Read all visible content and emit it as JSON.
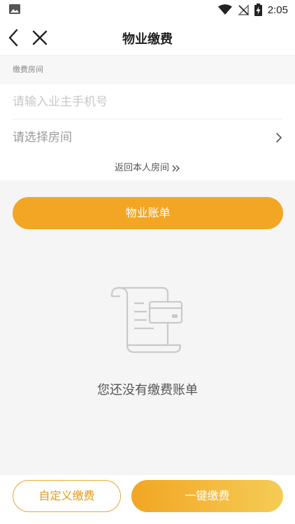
{
  "status_bar": {
    "time": "2:05"
  },
  "navbar": {
    "title": "物业缴费"
  },
  "section": {
    "label": "缴费房间"
  },
  "form": {
    "phone_placeholder": "请输入业主手机号",
    "room_placeholder": "请选择房间",
    "return_link": "返回本人房间"
  },
  "bill_button": {
    "label": "物业账单"
  },
  "empty_state": {
    "message": "您还没有缴费账单"
  },
  "bottom": {
    "custom_label": "自定义缴费",
    "onekey_label": "一键缴费"
  },
  "colors": {
    "accent": "#f2a623",
    "accent_light": "#f5cc56",
    "background": "#f5f5f5"
  }
}
